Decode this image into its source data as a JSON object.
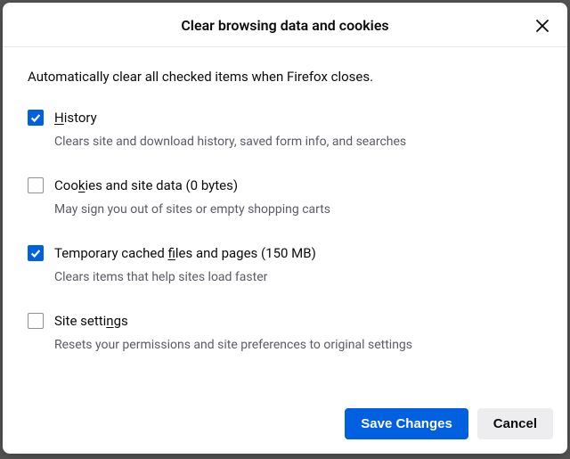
{
  "dialog": {
    "title": "Clear browsing data and cookies",
    "intro": "Automatically clear all checked items when Firefox closes."
  },
  "options": [
    {
      "checked": true,
      "accesskey": "H",
      "label_rest": "istory",
      "desc": "Clears site and download history, saved form info, and searches"
    },
    {
      "checked": false,
      "label_pre": "Coo",
      "accesskey": "k",
      "label_rest": "ies and site data (0 bytes)",
      "desc": "May sign you out of sites or empty shopping carts"
    },
    {
      "checked": true,
      "label_pre": "Temporary cached ",
      "accesskey": "f",
      "label_rest": "iles and pages (150 MB)",
      "desc": "Clears items that help sites load faster"
    },
    {
      "checked": false,
      "label_pre": "Site setti",
      "accesskey": "n",
      "label_rest": "gs",
      "desc": "Resets your permissions and site preferences to original settings"
    }
  ],
  "buttons": {
    "save": "Save Changes",
    "cancel": "Cancel"
  }
}
